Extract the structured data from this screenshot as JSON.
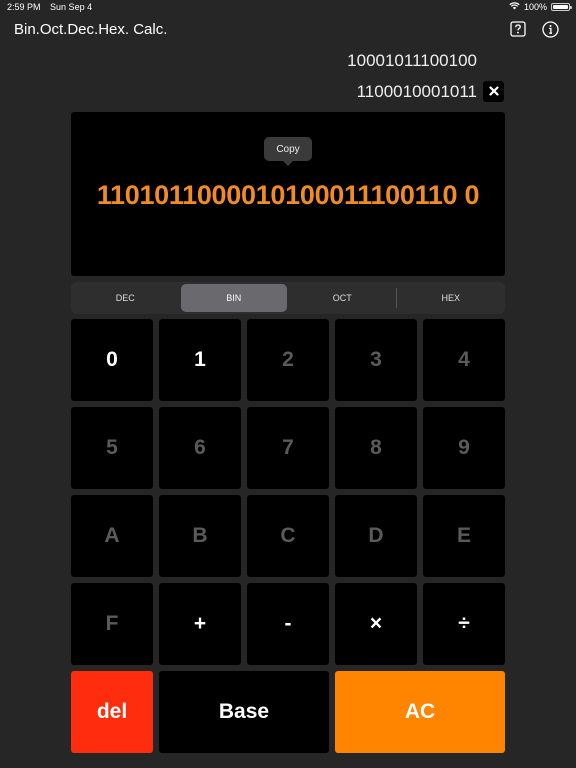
{
  "status_bar": {
    "time": "2:59 PM",
    "date": "Sun Sep 4",
    "battery": "100%"
  },
  "header": {
    "title": "Bin.Oct.Dec.Hex. Calc.",
    "help_icon": "question-square-icon",
    "info_icon": "info-circle-icon"
  },
  "history": {
    "operand1": "10001011100100",
    "operand2": "1100010001011",
    "clear_icon": "close-icon"
  },
  "display": {
    "tooltip": "Copy",
    "value": "1101011000010100011100110 0"
  },
  "base_tabs": {
    "items": [
      "DEC",
      "BIN",
      "OCT",
      "HEX"
    ],
    "selected": "BIN"
  },
  "keypad": {
    "digits": [
      "0",
      "1",
      "2",
      "3",
      "4",
      "5",
      "6",
      "7",
      "8",
      "9",
      "A",
      "B",
      "C",
      "D",
      "E",
      "F"
    ],
    "ops": [
      "+",
      "-",
      "×",
      "÷"
    ],
    "del": "del",
    "base": "Base",
    "ac": "AC"
  },
  "colors": {
    "background": "#262626",
    "result": "#f08c22",
    "del": "#ff2d0d",
    "ac": "#ff8400",
    "disabled_key": "#5a5a5a"
  }
}
